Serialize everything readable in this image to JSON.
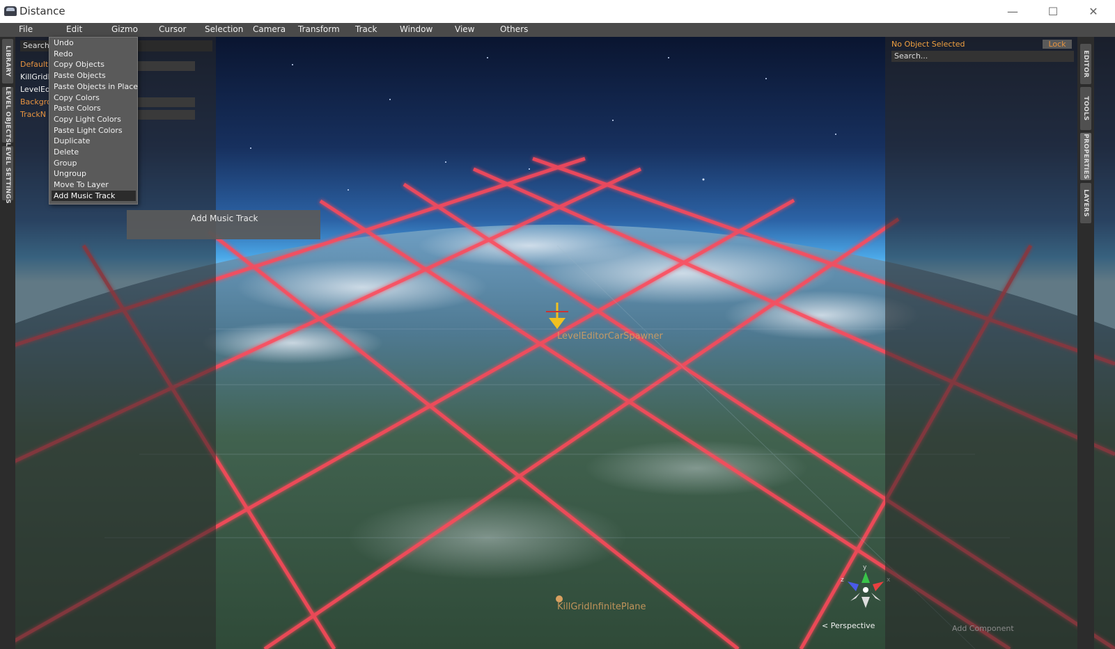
{
  "window": {
    "title": "Distance",
    "minimize": "—",
    "maximize": "☐",
    "close": "✕"
  },
  "menubar": [
    "File",
    "Edit",
    "Gizmo",
    "Cursor",
    "Selection",
    "Camera",
    "Transform",
    "Track",
    "Window",
    "View",
    "Others"
  ],
  "edit_menu": {
    "items": [
      "Undo",
      "Redo",
      "Copy Objects",
      "Paste Objects",
      "Paste Objects in Place",
      "Copy Colors",
      "Paste Colors",
      "Copy Light Colors",
      "Paste Light Colors",
      "Duplicate",
      "Delete",
      "Group",
      "Ungroup",
      "Move To Layer",
      "Add Music Track"
    ],
    "highlighted": "Add Music Track",
    "tooltip": "Add Music Track"
  },
  "left_panel": {
    "tabs": [
      "LIBRARY",
      "LEVEL OBJECTS",
      "LEVEL SETTINGS"
    ],
    "search": "Search...",
    "tree": [
      "Default",
      "KillGridIn",
      "LevelEdit",
      "Backgro",
      "TrackN"
    ]
  },
  "right_panel": {
    "tabs": [
      "EDITOR",
      "TOOLS",
      "PROPERTIES",
      "LAYERS"
    ],
    "status": "No Object Selected",
    "lock": "Lock",
    "search": "Search...",
    "add_component": "Add Component"
  },
  "viewport": {
    "object_labels": [
      "LevelEditorCarSpawner",
      "KillGridInfinitePlane"
    ],
    "camera_mode": "< Perspective",
    "gizmo_axes": [
      "y",
      "x",
      "z"
    ]
  },
  "colors": {
    "accent_orange": "#e89440",
    "grid_red": "#ff4a5a",
    "menubar": "#4a4a4a"
  }
}
